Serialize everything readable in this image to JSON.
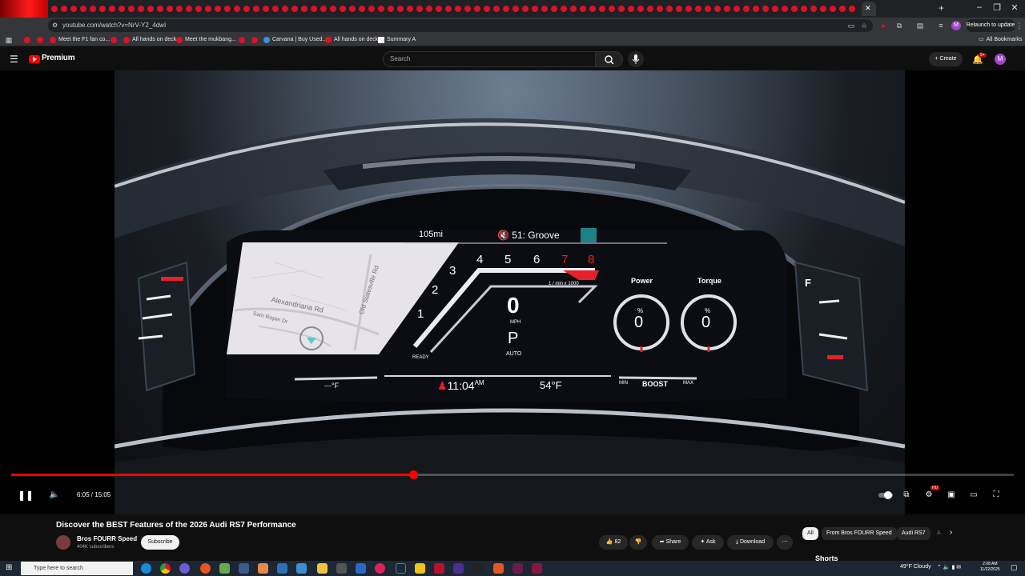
{
  "browser": {
    "url": "youtube.com/watch?v=NrV-Y2_4dwI",
    "relaunch_label": "Relaunch to update",
    "bookmarks": [
      {
        "label": "Meet the F1 fan co..."
      },
      {
        "label": "All hands on deck"
      },
      {
        "label": "Meet the mukbang..."
      },
      {
        "label": "Carvana | Buy Used..."
      },
      {
        "label": "All hands on deck"
      },
      {
        "label": "Summary A"
      }
    ],
    "all_bookmarks_label": "All Bookmarks"
  },
  "youtube": {
    "logo_text": "Premium",
    "search_placeholder": "Search",
    "create_label": "Create",
    "notification_badge": "9+",
    "avatar_letter": "M"
  },
  "player": {
    "timecode": "6:05 / 15:05",
    "progress_fraction": 0.4,
    "hd_badge": "HD"
  },
  "dashboard": {
    "range": "105mi",
    "media": "51: Groove",
    "gears": [
      "1",
      "2",
      "3",
      "4",
      "5",
      "6",
      "7",
      "8"
    ],
    "rpm_label": "1 / min x 1000",
    "speed": "0",
    "speed_unit": "MPH",
    "gear": "P",
    "gear_mode": "AUTO",
    "ready": "READY",
    "power_label": "Power",
    "torque_label": "Torque",
    "power_value": "0",
    "torque_value": "0",
    "percent": "%",
    "time": "11:04",
    "ampm": "AM",
    "temp": "54°F",
    "coolant": "---°F",
    "boost_min": "MIN",
    "boost_label": "BOOST",
    "boost_max": "MAX",
    "fuel_f": "F",
    "map_roads": [
      "Alexandriana Rd",
      "Old Statesville Rd",
      "Sam Roper Dr"
    ]
  },
  "video_info": {
    "title": "Discover the BEST Features of the 2026 Audi RS7 Performance",
    "channel": "Bros FOURR Speed",
    "subscribers": "404K subscribers",
    "subscribe_label": "Subscribe",
    "likes": "82",
    "share_label": "Share",
    "ask_label": "Ask",
    "download_label": "Download"
  },
  "chips": [
    {
      "label": "All"
    },
    {
      "label": "From Bros FOURR Speed"
    },
    {
      "label": "Audi RS7"
    },
    {
      "label": "A"
    }
  ],
  "shorts_label": "Shorts",
  "taskbar": {
    "search_placeholder": "Type here to search",
    "weather": "49°F  Cloudy",
    "time": "2:08 AM",
    "date": "11/22/2025"
  }
}
